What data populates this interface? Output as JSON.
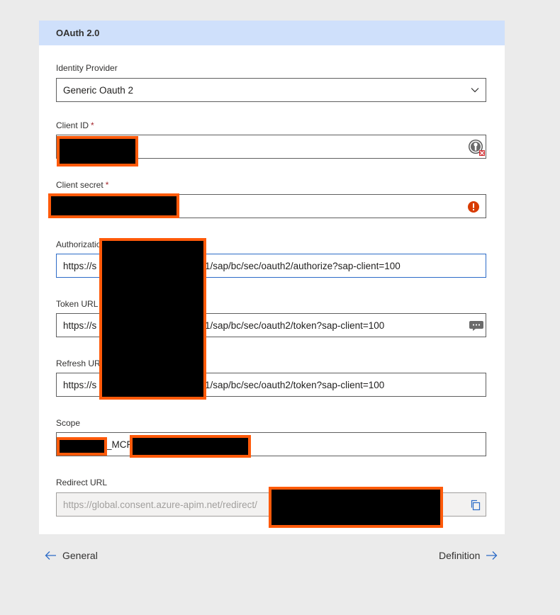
{
  "section": {
    "title": "OAuth 2.0"
  },
  "fields": {
    "identity_provider": {
      "label": "Identity Provider",
      "value": "Generic Oauth 2"
    },
    "client_id": {
      "label": "Client ID",
      "required_mark": "*",
      "value": ""
    },
    "client_secret": {
      "label": "Client secret",
      "required_mark": "*",
      "value": ""
    },
    "authorization_url": {
      "label": "Authorizatio",
      "value_prefix": "https://s",
      "value_suffix": "1/sap/bc/sec/oauth2/authorize?sap-client=100"
    },
    "token_url": {
      "label": "Token URL",
      "required_mark": "*",
      "value_prefix": "https://s",
      "value_suffix": "1/sap/bc/sec/oauth2/token?sap-client=100"
    },
    "refresh_url": {
      "label": "Refresh URL",
      "value_prefix": "https://s",
      "value_suffix": "1/sap/bc/sec/oauth2/token?sap-client=100"
    },
    "scope": {
      "label": "Scope",
      "value_visible": "_MCP"
    },
    "redirect_url": {
      "label": "Redirect URL",
      "value": "https://global.consent.azure-apim.net/redirect/"
    }
  },
  "icons": {
    "password_manager": "key-error-icon",
    "error": "error-icon",
    "comment": "comment-icon",
    "copy": "copy-icon",
    "dropdown": "chevron-down-icon",
    "back": "arrow-left-icon",
    "forward": "arrow-right-icon"
  },
  "nav": {
    "back_label": "General",
    "next_label": "Definition"
  },
  "colors": {
    "header_bg": "#cfe0fb",
    "accent": "#2c6bc7",
    "redaction": "#ff5a0a",
    "required": "#a4262c"
  }
}
